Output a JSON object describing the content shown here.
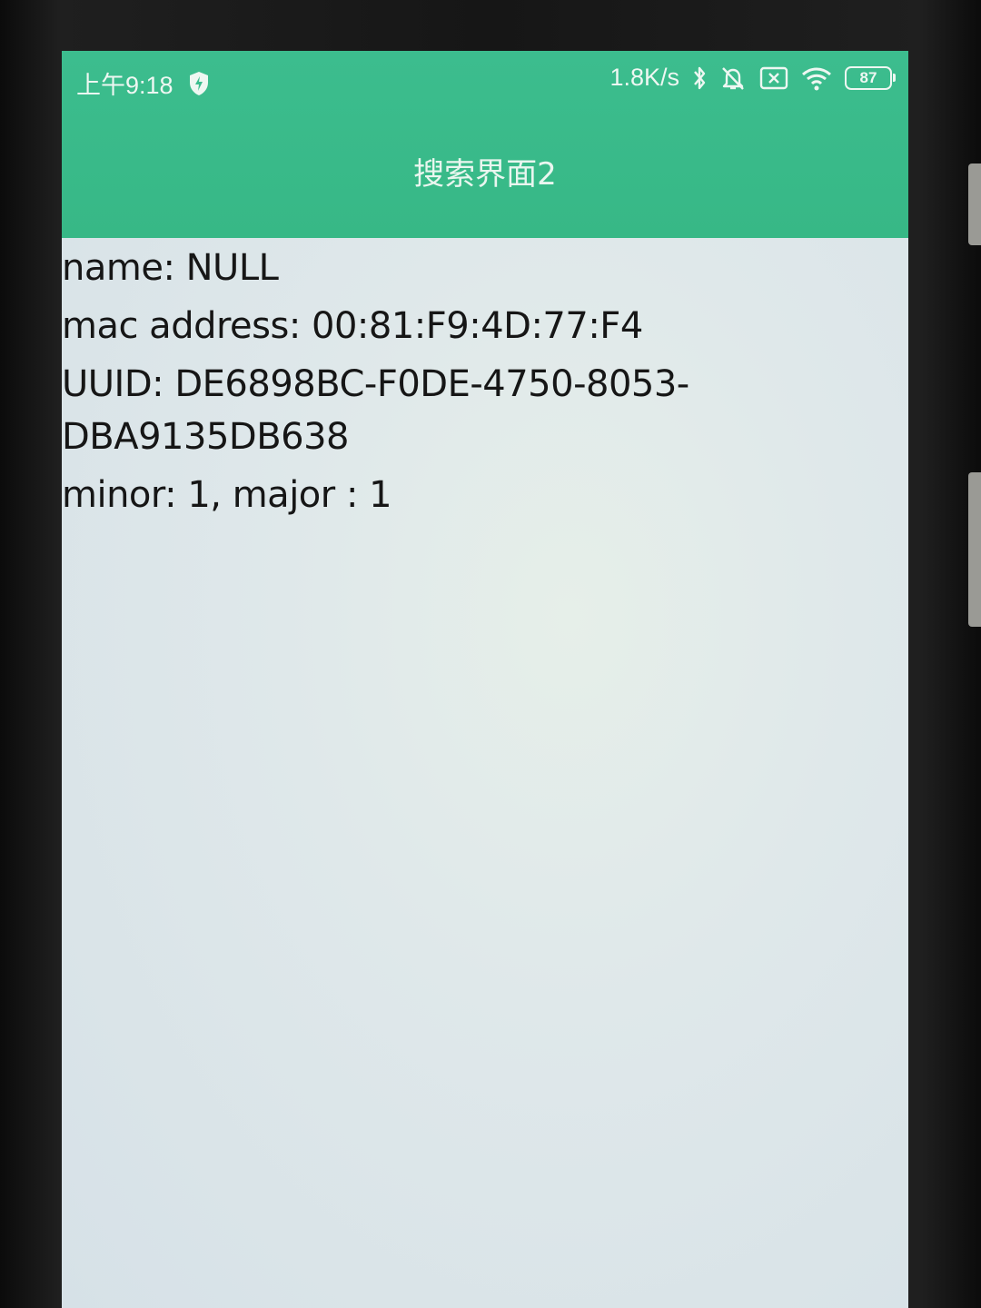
{
  "status_bar": {
    "time": "上午9:18",
    "network_speed": "1.8K/s",
    "battery_level": "87",
    "icons": [
      "shield-icon",
      "bluetooth-icon",
      "mute-bell-icon",
      "sim-x-icon",
      "wifi-icon",
      "battery-icon"
    ]
  },
  "app_bar": {
    "title": "搜索界面2",
    "color": "#3cbd8e"
  },
  "device_info": {
    "name": "name: NULL",
    "mac_address": "mac address: 00:81:F9:4D:77:F4",
    "uuid_line1": "UUID: DE6898BC-F0DE-4750-8053-",
    "uuid_line2": "DBA9135DB638",
    "minor_major": "minor: 1, major : 1"
  }
}
